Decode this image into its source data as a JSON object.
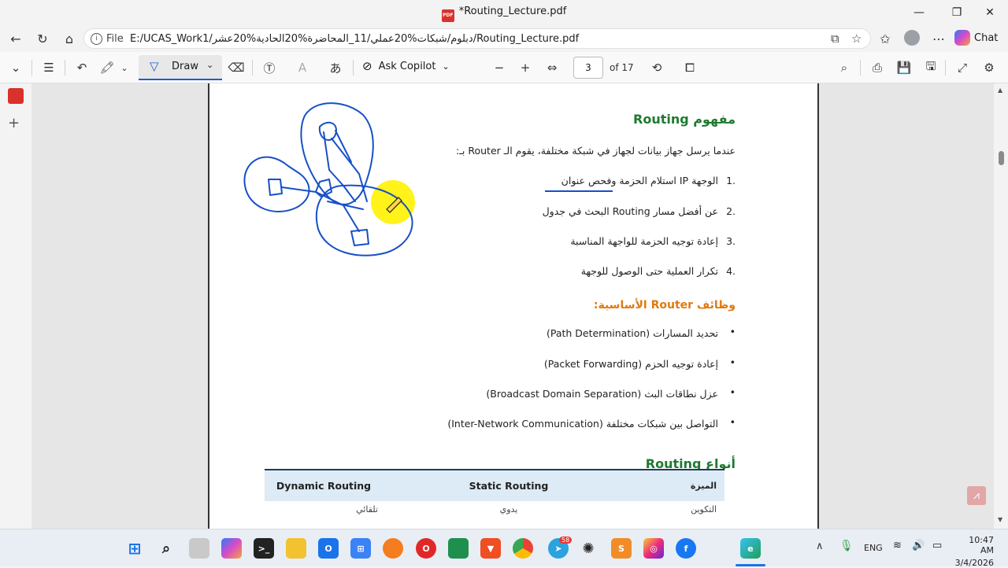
{
  "window": {
    "title": "*Routing_Lecture.pdf",
    "pdf_badge": "PDF"
  },
  "address": {
    "label": "File",
    "url": "E:/UCAS_Work1/دبلوم/شبكات%20عملي/11_المحاضرة%20الحادية%20عشر/Routing_Lecture.pdf",
    "chat_label": "Chat"
  },
  "toolbar": {
    "draw_label": "Draw",
    "copilot_label": "Ask Copilot",
    "page_value": "3",
    "page_total": "of 17"
  },
  "doc": {
    "heading1": "مفهوم Routing",
    "intro": "عندما يرسل جهاز بيانات لجهاز في شبكة مختلفة، يقوم الـ Router بـ:",
    "steps": [
      {
        "num": "1.",
        "text": "استلام الحزمة وفحص عنوان IP الوجهة"
      },
      {
        "num": "2.",
        "text": "البحث في جدول Routing عن أفضل مسار"
      },
      {
        "num": "3.",
        "text": "إعادة توجيه الحزمة للواجهة المناسبة"
      },
      {
        "num": "4.",
        "text": "تكرار العملية حتى الوصول للوجهة"
      }
    ],
    "heading2": "وظائف Router الأساسية:",
    "bullets": [
      "تحديد المسارات (Path Determination)",
      "إعادة توجيه الحزم (Packet Forwarding)",
      "عزل نطاقات البث (Broadcast Domain Separation)",
      "التواصل بين شبكات مختلفة (Inter-Network Communication)"
    ],
    "heading3": "أنواع Routing",
    "table": {
      "headers": [
        "الميزة",
        "Static Routing",
        "Dynamic Routing"
      ],
      "row1": [
        "التكوين",
        "يدوي",
        "تلقائي"
      ]
    }
  },
  "taskbar": {
    "lang": "ENG",
    "time": "10:47 AM",
    "date": "3/4/2026",
    "telegram_badge": "58"
  },
  "colors": {
    "accent": "#1f5bd1",
    "heading_green": "#1e7a30",
    "heading_orange": "#e07a10",
    "ink": "#1750c7",
    "highlight": "#fff200"
  }
}
